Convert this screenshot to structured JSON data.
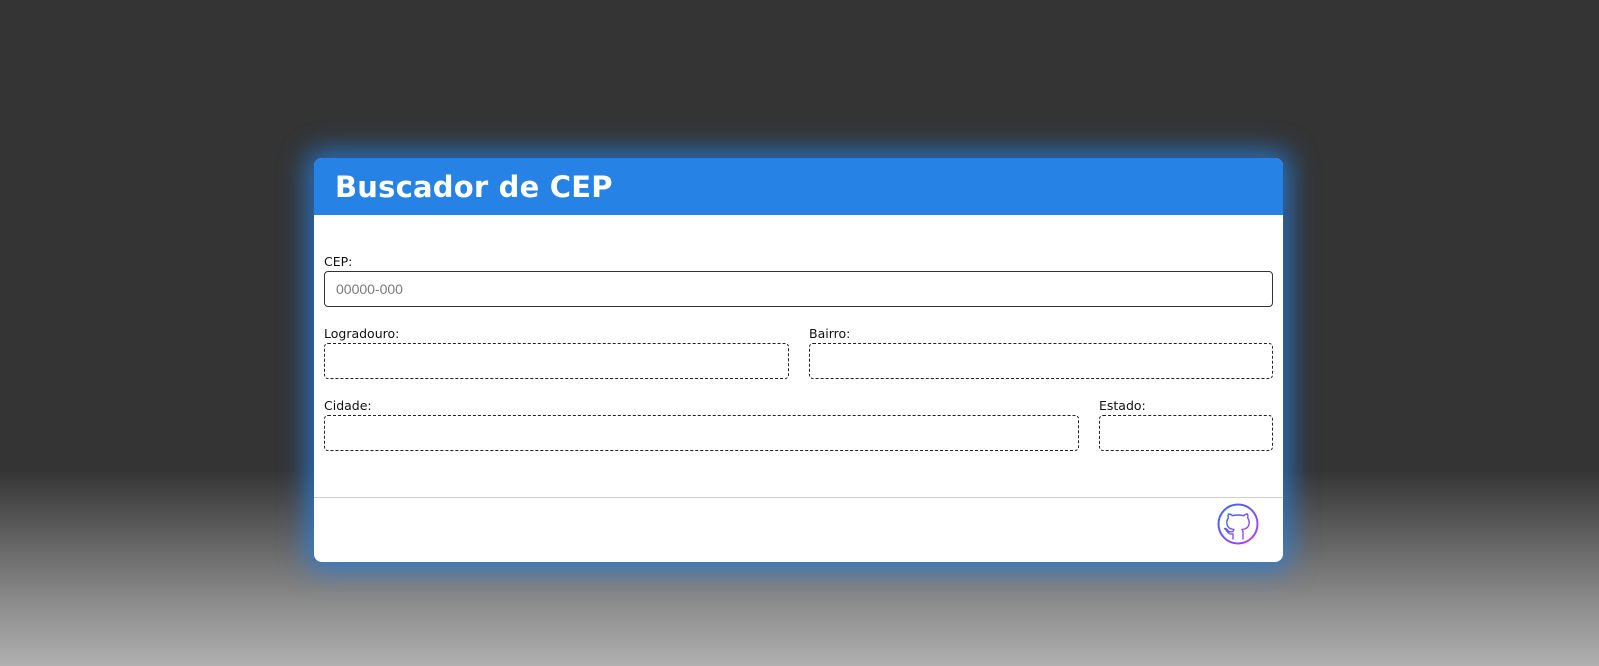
{
  "header": {
    "title": "Buscador de CEP"
  },
  "form": {
    "cep": {
      "label": "CEP:",
      "placeholder": "00000-000",
      "value": ""
    },
    "logradouro": {
      "label": "Logradouro:",
      "value": ""
    },
    "bairro": {
      "label": "Bairro:",
      "value": ""
    },
    "cidade": {
      "label": "Cidade:",
      "value": ""
    },
    "estado": {
      "label": "Estado:",
      "value": ""
    }
  },
  "footer": {
    "github_icon": "github-icon"
  },
  "colors": {
    "accent": "#2782e6",
    "background": "#343434",
    "card": "#ffffff",
    "icon_gradient_start": "#2b6cf0",
    "icon_gradient_end": "#c13cf5"
  }
}
